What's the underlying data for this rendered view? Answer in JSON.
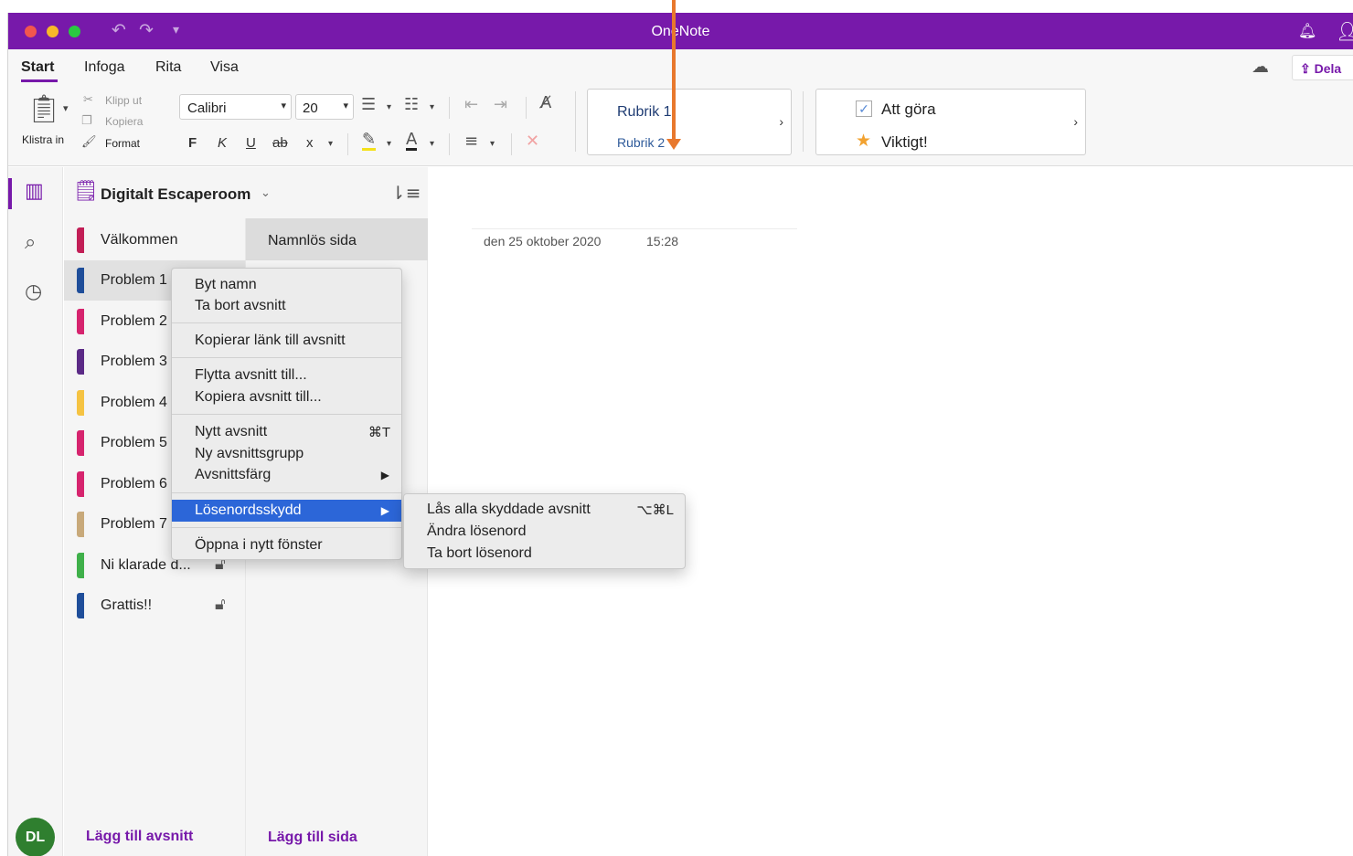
{
  "window": {
    "title": "OneNote"
  },
  "ribbon_tabs": [
    "Start",
    "Infoga",
    "Rita",
    "Visa"
  ],
  "share_label": "Dela",
  "clipboard": {
    "paste": "Klistra in",
    "cut": "Klipp ut",
    "copy": "Kopiera",
    "format": "Format"
  },
  "font": {
    "family": "Calibri",
    "size": "20"
  },
  "format_buttons": {
    "bold": "F",
    "italic": "K",
    "underline": "U",
    "strike": "ab",
    "subscript": "x"
  },
  "styles": {
    "h1": "Rubrik 1",
    "h2": "Rubrik 2"
  },
  "tags": {
    "todo": "Att göra",
    "important": "Viktigt!"
  },
  "notebook": {
    "name": "Digitalt Escaperoom"
  },
  "sections": [
    {
      "label": "Välkommen",
      "color": "#c21e56"
    },
    {
      "label": "Problem 1",
      "color": "#1f4e9a"
    },
    {
      "label": "Problem 2",
      "color": "#d6246e"
    },
    {
      "label": "Problem 3",
      "color": "#5b2a86"
    },
    {
      "label": "Problem 4",
      "color": "#f5c342"
    },
    {
      "label": "Problem 5",
      "color": "#d6246e"
    },
    {
      "label": "Problem 6",
      "color": "#d6246e"
    },
    {
      "label": "Problem 7",
      "color": "#c8a97a"
    },
    {
      "label": "Ni klarade d...",
      "color": "#3fb04a"
    },
    {
      "label": "Grattis!!",
      "color": "#1f4e9a"
    }
  ],
  "pages": [
    {
      "label": "Namnlös sida"
    }
  ],
  "page_meta": {
    "date": "den 25 oktober 2020",
    "time": "15:28"
  },
  "context_menu": {
    "rename": "Byt namn",
    "delete": "Ta bort avsnitt",
    "copy_link": "Kopierar länk till avsnitt",
    "move": "Flytta avsnitt till...",
    "copy": "Kopiera avsnitt till...",
    "new_section": "Nytt avsnitt",
    "new_section_shortcut": "⌘T",
    "new_group": "Ny avsnittsgrupp",
    "color": "Avsnittsfärg",
    "password": "Lösenordsskydd",
    "open_window": "Öppna i nytt fönster"
  },
  "password_submenu": {
    "lock_all": "Lås alla skyddade avsnitt",
    "lock_all_shortcut": "⌥⌘L",
    "change": "Ändra lösenord",
    "remove": "Ta bort lösenord"
  },
  "footer": {
    "add_section": "Lägg till avsnitt",
    "add_page": "Lägg till sida"
  },
  "user": {
    "initials": "DL"
  },
  "colors": {
    "accent": "#7719aa",
    "highlight": "#2c66d8",
    "annotation_arrow": "#e8782d"
  },
  "icons": [
    "undo-icon",
    "redo-icon",
    "bell-icon",
    "person-icon",
    "cloud-sync-icon",
    "share-icon",
    "paste-icon",
    "cut-icon",
    "copy-icon",
    "format-painter-icon",
    "bullets-icon",
    "numbering-icon",
    "outdent-icon",
    "indent-icon",
    "clear-format-icon",
    "highlight-icon",
    "font-color-icon",
    "align-icon",
    "library-icon",
    "search-icon",
    "recent-icon",
    "sort-icon",
    "lock-icon",
    "star-icon",
    "checkbox-icon"
  ]
}
